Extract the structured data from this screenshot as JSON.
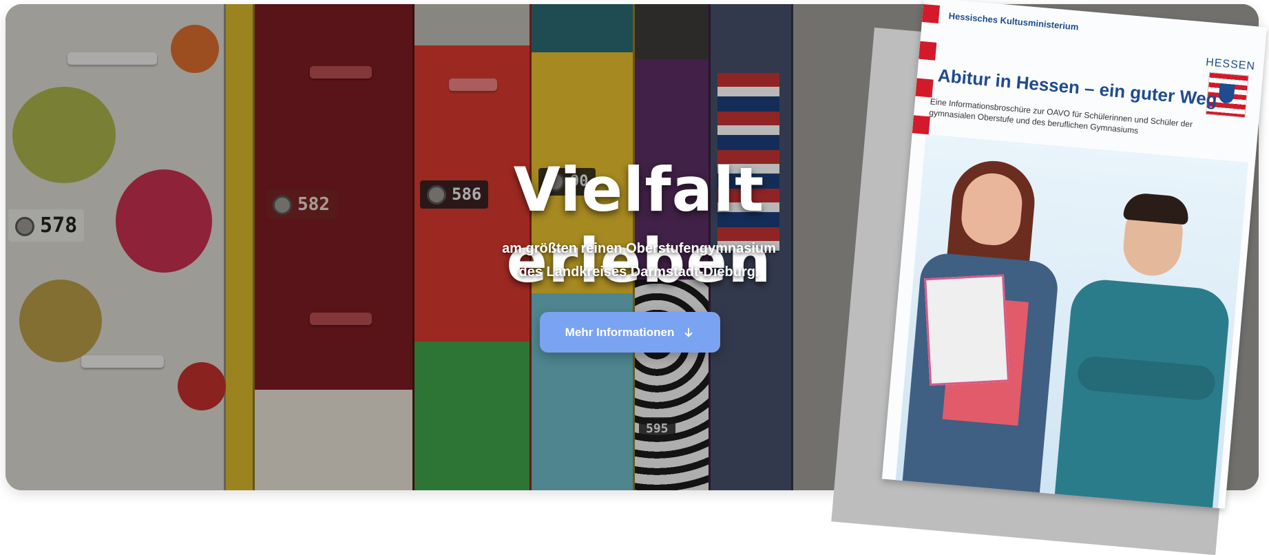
{
  "hero": {
    "title": "Vielfalt erleben",
    "subtitle_line1": "am größten reinen Oberstufengymnasium",
    "subtitle_line2": "des Landkreises Darmstadt-Dieburg.",
    "cta_label": "Mehr Informationen",
    "cta_icon": "arrow-down-icon",
    "cta_color": "#7aa3f2"
  },
  "lockers": {
    "numbers": [
      "578",
      "582",
      "586",
      "90",
      "595"
    ]
  },
  "brochure": {
    "ministry": "Hessisches Kultusministerium",
    "state_label": "HESSEN",
    "title": "Abitur in Hessen – ein guter Weg",
    "subtitle": "Eine Informationsbroschüre zur OAVO für Schülerinnen und Schüler der gymnasialen Oberstufe und des beruflichen Gymnasiums",
    "accent_color": "#d31a2b",
    "brand_color": "#1f4b8f"
  }
}
